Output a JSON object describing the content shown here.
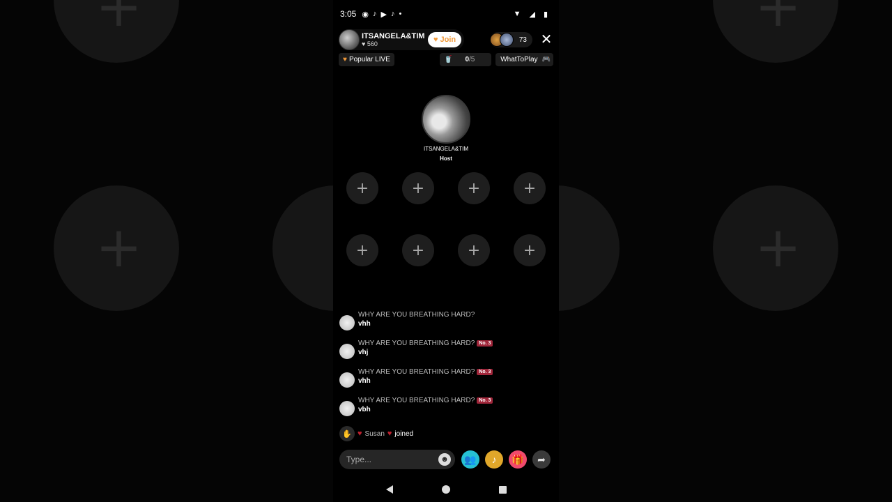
{
  "status_bar": {
    "time": "3:05",
    "icons": [
      "record-icon",
      "tiktok-icon",
      "youtube-icon",
      "tiktok-icon",
      "dot-icon",
      "wifi-icon",
      "signal-icon",
      "battery-icon"
    ]
  },
  "header": {
    "host_name": "ITSANGELA&TIM",
    "likes": "560",
    "join_label": "Join",
    "viewer_count": "73"
  },
  "subbar": {
    "popular_label": "Popular LIVE",
    "goal_current": "0",
    "goal_total": "/5",
    "game_label": "WhatToPlay"
  },
  "host_seat": {
    "name": "ITSANGELA&TIM",
    "role": "Host"
  },
  "seats": [
    "+",
    "+",
    "+",
    "+",
    "+",
    "+",
    "+",
    "+"
  ],
  "chat": [
    {
      "user": "WHY ARE YOU BREATHING HARD?",
      "badge": "",
      "text": "vhh"
    },
    {
      "user": "WHY ARE YOU BREATHING HARD?",
      "badge": "No. 3",
      "text": "vhj"
    },
    {
      "user": "WHY ARE YOU BREATHING HARD?",
      "badge": "No. 3",
      "text": "vhh"
    },
    {
      "user": "WHY ARE YOU BREATHING HARD?",
      "badge": "No. 3",
      "text": "vbh"
    }
  ],
  "join_event": {
    "name": "Susan",
    "action": "joined"
  },
  "input": {
    "placeholder": "Type..."
  },
  "colors": {
    "join_text": "#f29a3a",
    "badge": "#a0263a",
    "collab": "#26c1d4",
    "gift": "#f04a6c"
  }
}
